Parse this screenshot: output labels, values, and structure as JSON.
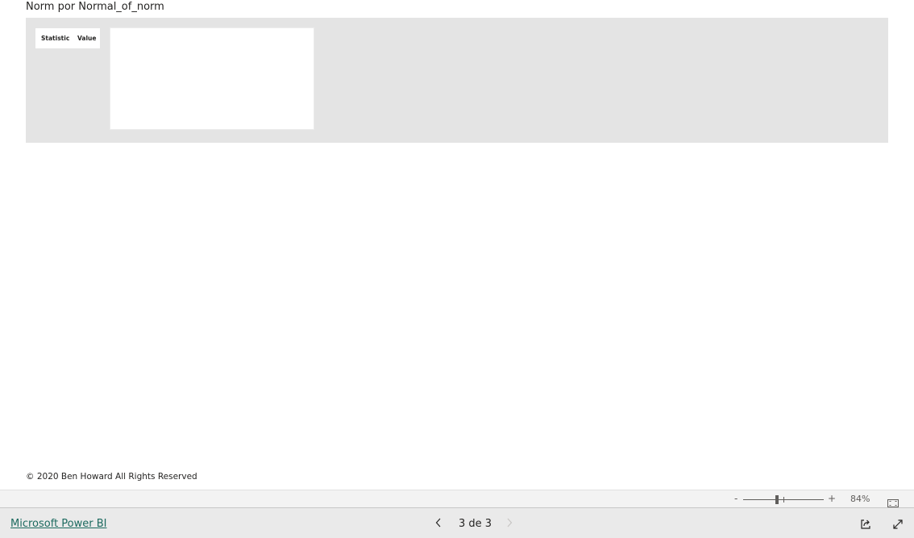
{
  "report": {
    "page_title": "Norm por Normal_of_norm",
    "stats_table": {
      "columns": [
        "Statistic",
        "Value"
      ]
    },
    "copyright": "© 2020 Ben Howard All Rights Reserved"
  },
  "zoom_bar": {
    "minus_label": "-",
    "plus_label": "+",
    "zoom_level": "84%",
    "zoom_value_percent": 84,
    "icons": {
      "fit_page": "fit-to-page-icon"
    }
  },
  "footer": {
    "brand_link": "Microsoft Power BI",
    "pager": {
      "label": "3 de 3",
      "current": 3,
      "total": 3,
      "prev_icon": "chevron-left-icon",
      "next_icon": "chevron-right-icon"
    },
    "icons": {
      "share": "share-icon",
      "fullscreen": "fullscreen-icon"
    }
  },
  "colors": {
    "panel_bg": "#e4e4e4",
    "link": "#1c6a5f",
    "bottom_bar_bg": "#eaeaea",
    "zoom_bar_bg": "#f3f3f3"
  }
}
